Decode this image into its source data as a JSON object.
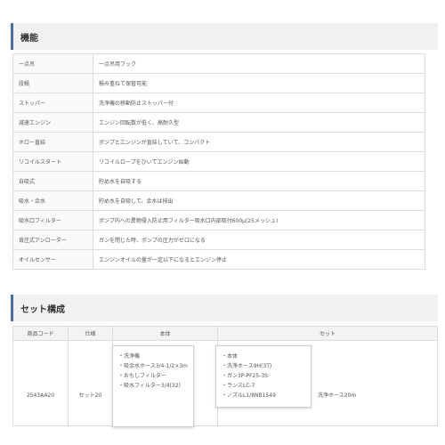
{
  "functions": {
    "title": "機能",
    "rows": [
      {
        "label": "一点吊",
        "value": "一点吊用フック"
      },
      {
        "label": "段積",
        "value": "積み重ねて保管可能"
      },
      {
        "label": "ストッパー",
        "value": "洗浄機の移動防止ストッパー付"
      },
      {
        "label": "減速エンジン",
        "value": "エンジン回転数が低く、高耐久型"
      },
      {
        "label": "ホロー直結",
        "value": "ポンプとエンジンが直結していて、コンパクト"
      },
      {
        "label": "リコイルスタート",
        "value": "リコイルロープをひいてエンジン始動"
      },
      {
        "label": "自吸式",
        "value": "貯め水を自吸する"
      },
      {
        "label": "吸水・余水",
        "value": "貯め水を自吸して、余水は排出"
      },
      {
        "label": "吸水口フィルター",
        "value": "ポンプ内への異物侵入防止用フィルター吸水口内部取付600μ(25メッシュ)"
      },
      {
        "label": "背圧式アンローダー",
        "value": "ガンを閉じた時、ポンプの圧力がゼロになる"
      },
      {
        "label": "オイルセンサー",
        "value": "エンジンオイルの量が一定以下になるとエンジン停止"
      }
    ]
  },
  "set_config": {
    "title": "セット構成",
    "headers": {
      "code": "商品コード",
      "spec": "仕様",
      "body": "本体",
      "set": "セット"
    },
    "row": {
      "code": "2543AA20",
      "spec": "セット20",
      "body_items": [
        "洗浄機",
        "吸余水ホース3/4-1/2×3m",
        "おもしフィルター",
        "吸水フィルター3/4(32)"
      ],
      "set_items": [
        "本体",
        "洗浄ホース9H(3T)",
        "ガン3P-PF25-3S",
        "ランスLC-7",
        "ノズルL1/8NB1549"
      ],
      "set_extra": "洗浄ホース20m"
    }
  }
}
